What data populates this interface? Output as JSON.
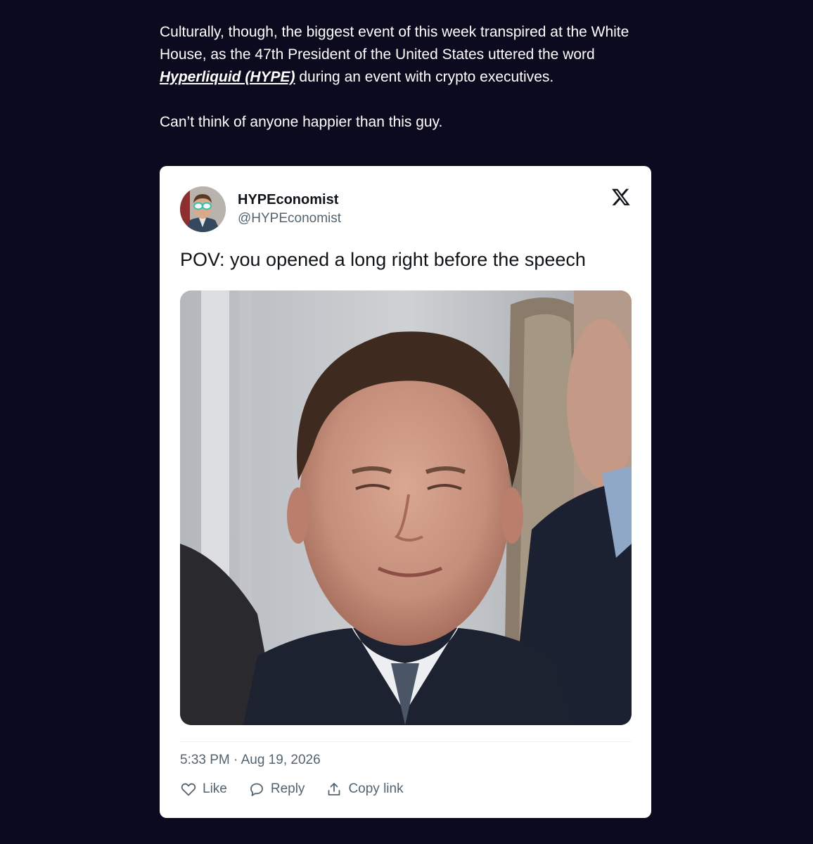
{
  "article": {
    "para1_before": "Culturally, though, the biggest event of this week transpired at the White House, as the 47th President of the United States uttered the word ",
    "para1_link": "Hyperliquid (HYPE)",
    "para1_after": " during an event with crypto executives.",
    "para2": "Can’t think of anyone happier than this guy."
  },
  "tweet": {
    "display_name": "HYPEconomist",
    "handle": "@HYPEconomist",
    "text": "POV: you opened a long right before the speech",
    "timestamp": "5:33 PM · Aug 19, 2026",
    "actions": {
      "like": "Like",
      "reply": "Reply",
      "copy": "Copy link"
    }
  },
  "icons": {
    "brand": "x-logo-icon",
    "like": "heart-icon",
    "reply": "speech-bubble-icon",
    "copy": "share-upload-icon"
  },
  "colors": {
    "page_background": "#0c0a1f",
    "card_background": "#ffffff",
    "primary_text": "#0f1419",
    "secondary_text": "#536471"
  }
}
